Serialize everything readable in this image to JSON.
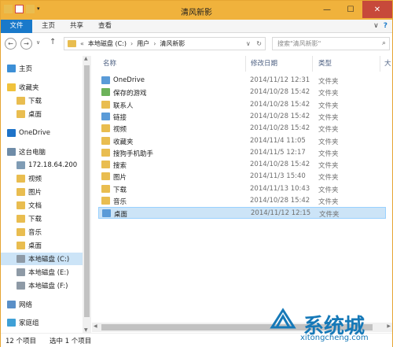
{
  "window": {
    "title": "清风新影",
    "buttons": {
      "minimize": "—",
      "maximize": "☐",
      "close": "✕"
    }
  },
  "ribbon": {
    "tabs": [
      "文件",
      "主页",
      "共享",
      "查看"
    ],
    "expand": "∨",
    "help": "?"
  },
  "address": {
    "back": "←",
    "forward": "→",
    "recent": "∨",
    "up": "↑",
    "segments": [
      "«",
      "本地磁盘 (C:)",
      "›",
      "用户",
      "›",
      "清风新影"
    ],
    "dropdown": "∨",
    "refresh": "↻",
    "search_placeholder": "搜索\"清风新影\"",
    "search_icon": "search-icon"
  },
  "sidebar": {
    "items": [
      {
        "label": "主页",
        "icon": "home-icon",
        "indent": 0
      },
      {
        "label": "收藏夹",
        "icon": "star-icon",
        "indent": 0
      },
      {
        "label": "下载",
        "icon": "download-folder-icon",
        "indent": 1
      },
      {
        "label": "桌面",
        "icon": "desktop-folder-icon",
        "indent": 1
      },
      {
        "label": "OneDrive",
        "icon": "cloud-icon",
        "indent": 0
      },
      {
        "label": "这台电脑",
        "icon": "computer-icon",
        "indent": 0
      },
      {
        "label": "172.18.64.200",
        "icon": "network-drive-icon",
        "indent": 1
      },
      {
        "label": "视频",
        "icon": "video-folder-icon",
        "indent": 1
      },
      {
        "label": "图片",
        "icon": "pictures-folder-icon",
        "indent": 1
      },
      {
        "label": "文档",
        "icon": "documents-folder-icon",
        "indent": 1
      },
      {
        "label": "下载",
        "icon": "download-folder-icon",
        "indent": 1
      },
      {
        "label": "音乐",
        "icon": "music-folder-icon",
        "indent": 1
      },
      {
        "label": "桌面",
        "icon": "desktop-folder-icon",
        "indent": 1
      },
      {
        "label": "本地磁盘 (C:)",
        "icon": "drive-icon",
        "indent": 1,
        "selected": true
      },
      {
        "label": "本地磁盘 (E:)",
        "icon": "drive-icon",
        "indent": 1
      },
      {
        "label": "本地磁盘 (F:)",
        "icon": "drive-icon",
        "indent": 1
      },
      {
        "label": "网络",
        "icon": "network-icon",
        "indent": 0
      },
      {
        "label": "家庭组",
        "icon": "homegroup-icon",
        "indent": 0
      }
    ]
  },
  "columns": [
    "名称",
    "修改日期",
    "类型",
    "大"
  ],
  "files": [
    {
      "name": "OneDrive",
      "date": "2014/11/12 12:31",
      "type": "文件夹",
      "icon": "cloud-folder-icon"
    },
    {
      "name": "保存的游戏",
      "date": "2014/10/28 15:42",
      "type": "文件夹",
      "icon": "games-folder-icon"
    },
    {
      "name": "联系人",
      "date": "2014/10/28 15:42",
      "type": "文件夹",
      "icon": "contacts-folder-icon"
    },
    {
      "name": "链接",
      "date": "2014/10/28 15:42",
      "type": "文件夹",
      "icon": "links-folder-icon"
    },
    {
      "name": "视频",
      "date": "2014/10/28 15:42",
      "type": "文件夹",
      "icon": "video-folder-icon"
    },
    {
      "name": "收藏夹",
      "date": "2014/11/4 11:05",
      "type": "文件夹",
      "icon": "favorites-folder-icon"
    },
    {
      "name": "搜狗手机助手",
      "date": "2014/11/5 12:17",
      "type": "文件夹",
      "icon": "folder-icon"
    },
    {
      "name": "搜索",
      "date": "2014/10/28 15:42",
      "type": "文件夹",
      "icon": "searches-folder-icon"
    },
    {
      "name": "图片",
      "date": "2014/11/3 15:40",
      "type": "文件夹",
      "icon": "pictures-folder-icon"
    },
    {
      "name": "下载",
      "date": "2014/11/13 10:43",
      "type": "文件夹",
      "icon": "download-folder-icon"
    },
    {
      "name": "音乐",
      "date": "2014/10/28 15:42",
      "type": "文件夹",
      "icon": "music-folder-icon"
    },
    {
      "name": "桌面",
      "date": "2014/11/12 12:15",
      "type": "文件夹",
      "icon": "desktop-folder-icon",
      "selected": true
    }
  ],
  "status": {
    "count": "12 个项目",
    "selected": "选中 1 个项目"
  },
  "watermark": {
    "text": "系统城",
    "url": "xitongcheng.com"
  },
  "colors": {
    "title_bar": "#f0b23c",
    "file_tab": "#1979ca",
    "selection": "#cce4f7",
    "folder": "#e9bd50",
    "watermark": "#1679b8"
  }
}
